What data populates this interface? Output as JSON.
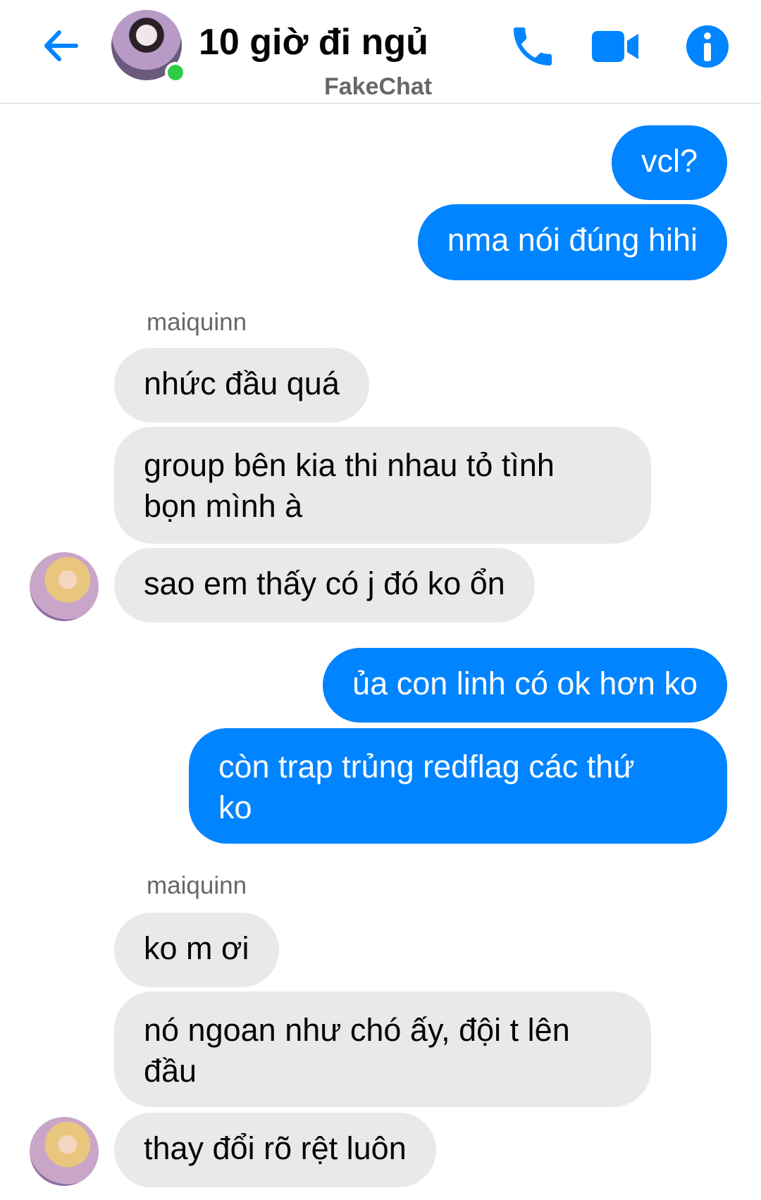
{
  "header": {
    "title": "10 giờ đi ngủ",
    "subtitle": "FakeChat",
    "accent_color": "#0084ff",
    "online_color": "#31cc46",
    "icons": [
      "back-arrow-icon",
      "phone-icon",
      "video-camera-icon",
      "info-icon"
    ]
  },
  "messages": [
    {
      "direction": "out",
      "text": "vcl?"
    },
    {
      "direction": "out",
      "text": "nma nói đúng hihi"
    },
    {
      "sender": "maiquinn"
    },
    {
      "direction": "in",
      "text": "nhức đầu quá"
    },
    {
      "direction": "in",
      "line1": "group bên kia thi nhau tỏ tình",
      "line2": "bọn mình à"
    },
    {
      "direction": "in",
      "text": "sao em thấy có j đó ko ổn"
    },
    {
      "direction": "out",
      "text": "ủa con linh có ok hơn ko"
    },
    {
      "direction": "out",
      "line1": "còn trap trủng redflag các thứ",
      "line2": "ko"
    },
    {
      "sender": "maiquinn"
    },
    {
      "direction": "in",
      "text": "ko m ơi"
    },
    {
      "direction": "in",
      "line1": "nó ngoan như chó ấy, đội t lên",
      "line2": "đầu"
    },
    {
      "direction": "in",
      "text": "thay đổi rõ rệt luôn"
    }
  ],
  "colors": {
    "outgoing_bubble": "#0084ff",
    "incoming_bubble": "#e9e9eb",
    "sender_label": "#65676b"
  }
}
